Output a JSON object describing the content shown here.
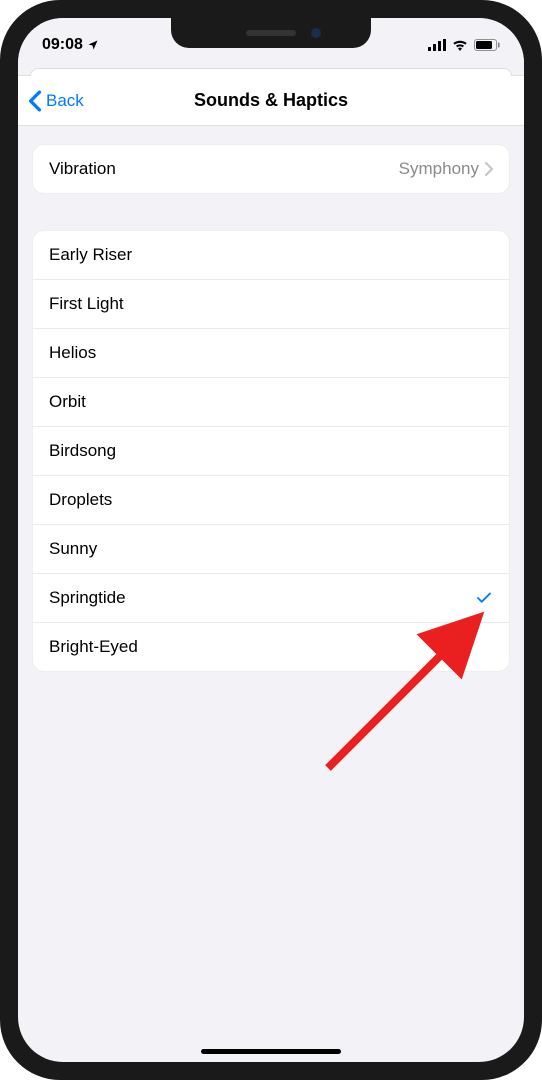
{
  "status": {
    "time": "09:08",
    "location_icon": "location-arrow",
    "signal": "signal-icon",
    "wifi": "wifi-icon",
    "battery": "battery-icon"
  },
  "nav": {
    "back_label": "Back",
    "title": "Sounds & Haptics"
  },
  "vibration": {
    "label": "Vibration",
    "value": "Symphony"
  },
  "sounds": [
    {
      "label": "Early Riser",
      "selected": false
    },
    {
      "label": "First Light",
      "selected": false
    },
    {
      "label": "Helios",
      "selected": false
    },
    {
      "label": "Orbit",
      "selected": false
    },
    {
      "label": "Birdsong",
      "selected": false
    },
    {
      "label": "Droplets",
      "selected": false
    },
    {
      "label": "Sunny",
      "selected": false
    },
    {
      "label": "Springtide",
      "selected": true
    },
    {
      "label": "Bright-Eyed",
      "selected": false
    }
  ],
  "colors": {
    "accent": "#007aff",
    "annotation": "#ea2020"
  }
}
